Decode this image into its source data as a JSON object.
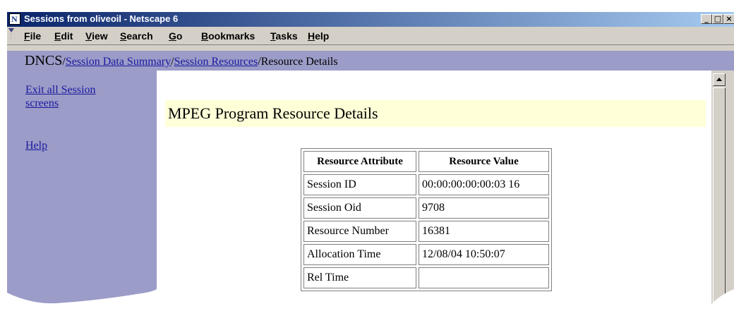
{
  "window": {
    "title": "Sessions from oliveoil - Netscape 6",
    "app_icon_letter": "N",
    "controls": {
      "minimize": "_",
      "maximize": "□",
      "close": "×"
    }
  },
  "menubar": {
    "items": [
      {
        "label": "File",
        "mnemonic": "F",
        "rest": "ile"
      },
      {
        "label": "Edit",
        "mnemonic": "E",
        "rest": "dit"
      },
      {
        "label": "View",
        "mnemonic": "V",
        "rest": "iew"
      },
      {
        "label": "Search",
        "mnemonic": "S",
        "rest": "earch"
      },
      {
        "label": "Go",
        "mnemonic": "G",
        "rest": "o"
      },
      {
        "label": "Bookmarks",
        "mnemonic": "B",
        "rest": "ookmarks"
      },
      {
        "label": "Tasks",
        "mnemonic": "T",
        "rest": "asks"
      },
      {
        "label": "Help",
        "mnemonic": "H",
        "rest": "elp"
      }
    ]
  },
  "breadcrumb": {
    "root": "DNCS",
    "separator": "/",
    "links": [
      "Session Data Summary",
      "Session Resources"
    ],
    "current": "Resource Details"
  },
  "sidebar": {
    "exit_line1": "Exit all Session",
    "exit_line2": "screens",
    "help": "Help"
  },
  "main": {
    "title": "MPEG Program Resource Details",
    "table": {
      "headers": [
        "Resource Attribute",
        "Resource Value"
      ],
      "rows": [
        {
          "attr": "Session ID",
          "value": "00:00:00:00:00:03 16"
        },
        {
          "attr": "Session Oid",
          "value": "9708"
        },
        {
          "attr": "Resource Number",
          "value": "16381"
        },
        {
          "attr": "Allocation Time",
          "value": "12/08/04 10:50:07"
        },
        {
          "attr": "Rel Time",
          "value": ""
        }
      ]
    }
  },
  "colors": {
    "titlebar_start": "#0a246a",
    "titlebar_end": "#a6caf0",
    "sidebar_bg": "#9c9cc8",
    "title_bg": "#ffffd8",
    "link": "#1a1aa0"
  }
}
